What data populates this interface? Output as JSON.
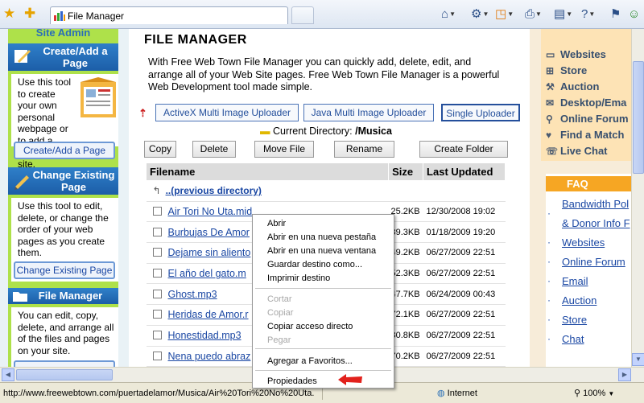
{
  "browser": {
    "tab_title": "File Manager",
    "toolbar_icons": [
      "home-icon",
      "feeds-icon",
      "print-icon",
      "page-icon",
      "help-icon",
      "research-icon",
      "messenger-icon"
    ]
  },
  "left_sidebar": {
    "title": "Site Admin",
    "sections": [
      {
        "heading": "Create/Add a Page",
        "text": "Use this tool to create your own personal webpage or to add a page to your site.",
        "button": "Create/Add a Page"
      },
      {
        "heading": "Change Existing Page",
        "text": "Use this tool to edit, delete, or change the order of your web pages as you create them.",
        "button": "Change Existing Page"
      },
      {
        "heading": "File Manager",
        "text": "You can edit, copy, delete, and arrange all of the files and pages on your site.",
        "button": ""
      }
    ]
  },
  "main": {
    "title": "FILE MANAGER",
    "intro": "With Free Web Town File Manager you can quickly add, delete, edit, and arrange all of your Web Site pages. Free Web Town File Manager is a powerful Web Development tool made simple.",
    "uploaders": [
      "ActiveX Multi Image Uploader",
      "Java Multi Image Uploader",
      "Single Uploader"
    ],
    "current_directory_label": "Current Directory:",
    "current_directory": "/Musica",
    "actions": [
      "Copy",
      "Delete",
      "Move File",
      "Rename",
      "Create Folder"
    ],
    "table": {
      "headers": [
        "Filename",
        "Size",
        "Last Updated"
      ],
      "parent_link": "..(previous directory)",
      "rows": [
        {
          "name": "Air Tori No Uta.mid",
          "size": "25.2KB",
          "date": "12/30/2008 19:02"
        },
        {
          "name": "Burbujas De Amor",
          "size": "39.3KB",
          "date": "01/18/2009 19:20"
        },
        {
          "name": "Dejame sin aliento",
          "size": "49.2KB",
          "date": "06/27/2009 22:51"
        },
        {
          "name": "El año del gato.m",
          "size": "52.3KB",
          "date": "06/27/2009 22:51"
        },
        {
          "name": "Ghost.mp3",
          "size": "47.7KB",
          "date": "06/24/2009 00:43"
        },
        {
          "name": "Heridas de Amor.r",
          "size": "72.1KB",
          "date": "06/27/2009 22:51"
        },
        {
          "name": "Honestidad.mp3",
          "size": "80.8KB",
          "date": "06/27/2009 22:51"
        },
        {
          "name": "Nena puedo abraz",
          "size": "70.2KB",
          "date": "06/27/2009 22:51"
        }
      ]
    }
  },
  "right_sidebar": {
    "items": [
      {
        "icon": "monitor-icon",
        "label": "Websites"
      },
      {
        "icon": "cart-icon",
        "label": "Store"
      },
      {
        "icon": "gavel-icon",
        "label": "Auction"
      },
      {
        "icon": "mail-icon",
        "label": "Desktop/Ema"
      },
      {
        "icon": "search-icon",
        "label": "Online Forum"
      },
      {
        "icon": "heart-icon",
        "label": "Find a Match"
      },
      {
        "icon": "chat-icon",
        "label": "Live Chat"
      }
    ],
    "faq_heading": "FAQ",
    "faq_links": [
      "Bandwidth Pol",
      "& Donor Info F",
      "Websites",
      "Online Forum",
      "Email",
      "Auction",
      "Store",
      "Chat"
    ]
  },
  "context_menu": {
    "groups": [
      [
        {
          "label": "Abrir",
          "enabled": true
        },
        {
          "label": "Abrir en una nueva pestaña",
          "enabled": true
        },
        {
          "label": "Abrir en una nueva ventana",
          "enabled": true
        },
        {
          "label": "Guardar destino como...",
          "enabled": true
        },
        {
          "label": "Imprimir destino",
          "enabled": true
        }
      ],
      [
        {
          "label": "Cortar",
          "enabled": false
        },
        {
          "label": "Copiar",
          "enabled": false
        },
        {
          "label": "Copiar acceso directo",
          "enabled": true
        },
        {
          "label": "Pegar",
          "enabled": false
        }
      ],
      [
        {
          "label": "Agregar a Favoritos...",
          "enabled": true
        }
      ],
      [
        {
          "label": "Propiedades",
          "enabled": true
        }
      ]
    ]
  },
  "status_bar": {
    "url": "http://www.freewebtown.com/puertadelamor/Musica/Air%20Tori%20No%20Uta.",
    "zone": "Internet",
    "zoom": "100%"
  }
}
